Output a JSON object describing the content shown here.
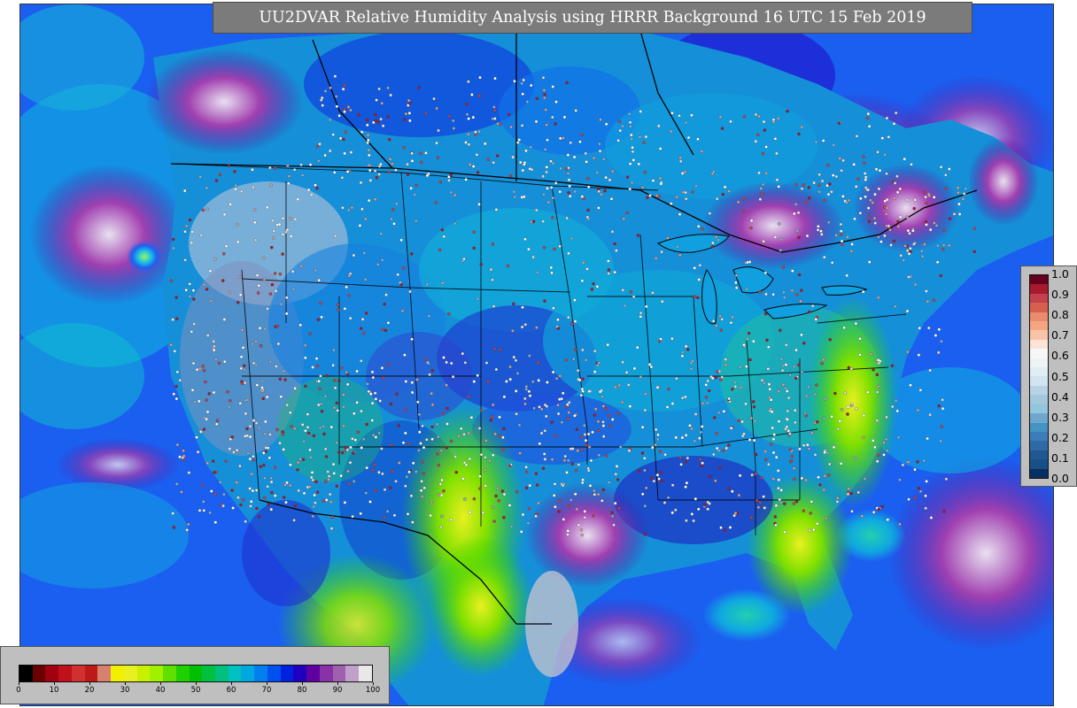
{
  "title": "UU2DVAR Relative Humidity Analysis using HRRR Background 16 UTC 15 Feb 2019",
  "obs_colorbar": {
    "ticks": [
      "1.0",
      "0.9",
      "0.8",
      "0.7",
      "0.6",
      "0.5",
      "0.4",
      "0.3",
      "0.2",
      "0.1",
      "0.0"
    ],
    "colors_top_to_bottom": [
      "#67001f",
      "#a51a2c",
      "#c4404a",
      "#d6604d",
      "#e98b6e",
      "#f4a582",
      "#f7c4a8",
      "#fbe3d6",
      "#f7f7f7",
      "#eef3f6",
      "#e0edf3",
      "#d1e5f0",
      "#b7d3e6",
      "#a3c8dc",
      "#92c5de",
      "#6fa7cc",
      "#4393c3",
      "#3a7db8",
      "#2f6aa6",
      "#215891",
      "#1a4f86",
      "#053061"
    ]
  },
  "rh_colorbar": {
    "ticks": [
      "0",
      "10",
      "20",
      "30",
      "40",
      "50",
      "60",
      "70",
      "80",
      "90",
      "100"
    ],
    "colors": [
      "#000000",
      "#6b0000",
      "#a00010",
      "#c0101a",
      "#d03030",
      "#c01818",
      "#d88070",
      "#f0f000",
      "#e8f020",
      "#c8f000",
      "#a0f000",
      "#60e000",
      "#20d000",
      "#00c000",
      "#00c040",
      "#00c080",
      "#00c0c0",
      "#00a8e0",
      "#0080f0",
      "#0050f0",
      "#0020e0",
      "#2000c0",
      "#6000a0",
      "#8a30a8",
      "#a060b0",
      "#c0a0c8",
      "#e8e8e8"
    ]
  },
  "map_colors": {
    "ocean": "#1a66f0",
    "boundary": "#000000",
    "moist": "#00a0e0",
    "dry": "#40e000"
  }
}
